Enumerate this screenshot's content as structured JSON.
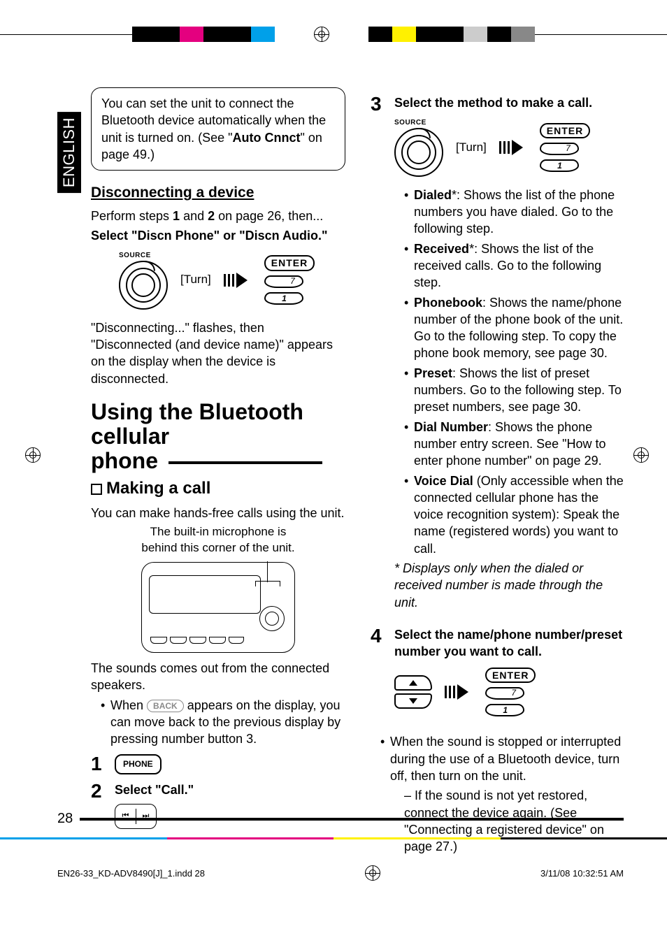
{
  "language_tab": "ENGLISH",
  "note_box": {
    "line1": "You can set the unit to connect the Bluetooth device automatically when the unit is turned on. (See \"",
    "bold": "Auto Cnnct",
    "line2": "\" on page 49.)"
  },
  "disconnect": {
    "heading": "Disconnecting a device",
    "perform_pre": "Perform steps ",
    "perform_b1": "1",
    "perform_mid": " and ",
    "perform_b2": "2",
    "perform_post": " on page 26, then...",
    "select_line": "Select \"Discn Phone\" or \"Discn Audio.\"",
    "result": "\"Disconnecting...\" flashes, then \"Disconnected (and device name)\" appears on the display when the device is disconnected."
  },
  "diagram": {
    "source": "SOURCE",
    "turn": "[Turn]",
    "enter": "ENTER"
  },
  "section": {
    "h1a": "Using the Bluetooth cellular",
    "h1b": "phone",
    "h2": "Making a call",
    "intro": "You can make hands-free calls using the unit.",
    "mic1": "The built-in microphone is",
    "mic2": "behind this corner of the unit.",
    "sounds": "The sounds comes out from the connected speakers.",
    "back_pre": "When ",
    "back_label": "BACK",
    "back_post": " appears on the display, you can move back to the previous display by pressing number button 3."
  },
  "steps_left": {
    "s1_num": "1",
    "s1_btn": "PHONE",
    "s2_num": "2",
    "s2_text": "Select \"Call.\""
  },
  "steps_right": {
    "s3_num": "3",
    "s3_text": "Select the method to make a call.",
    "s4_num": "4",
    "s4_text": "Select the name/phone number/preset number you want to call."
  },
  "methods": {
    "dialed_b": "Dialed",
    "dialed_t": "*: Shows the list of the phone numbers you have dialed. Go to the following step.",
    "received_b": "Received",
    "received_t": "*: Shows the list of the received calls. Go to the following step.",
    "phonebook_b": "Phonebook",
    "phonebook_t": ": Shows the name/phone number of the phone book of the unit. Go to the following step. To copy the phone book memory, see page 30.",
    "preset_b": "Preset",
    "preset_t": ": Shows the list of preset numbers. Go to the following step. To preset numbers, see page 30.",
    "dialnumber_b": "Dial Number",
    "dialnumber_t": ": Shows the phone number entry screen. See \"How to enter phone number\" on page 29.",
    "voicedial_b": "Voice Dial",
    "voicedial_t": " (Only accessible when the connected cellular phone has the voice recognition system): Speak the name (registered words) you want to call.",
    "footnote": "Displays only when the dialed or received number is made through the unit."
  },
  "post4": {
    "p1": "When the sound is stopped or interrupted during the use of a Bluetooth device, turn off, then turn on the unit.",
    "p2": "If the sound is not yet restored, connect the device again. (See \"Connecting a registered device\" on page 27.)"
  },
  "page_number": "28",
  "footer": {
    "file": "EN26-33_KD-ADV8490[J]_1.indd   28",
    "date": "3/11/08   10:32:51 AM"
  },
  "rocker_glyphs": {
    "prev": "⏮",
    "next": "⏭"
  }
}
